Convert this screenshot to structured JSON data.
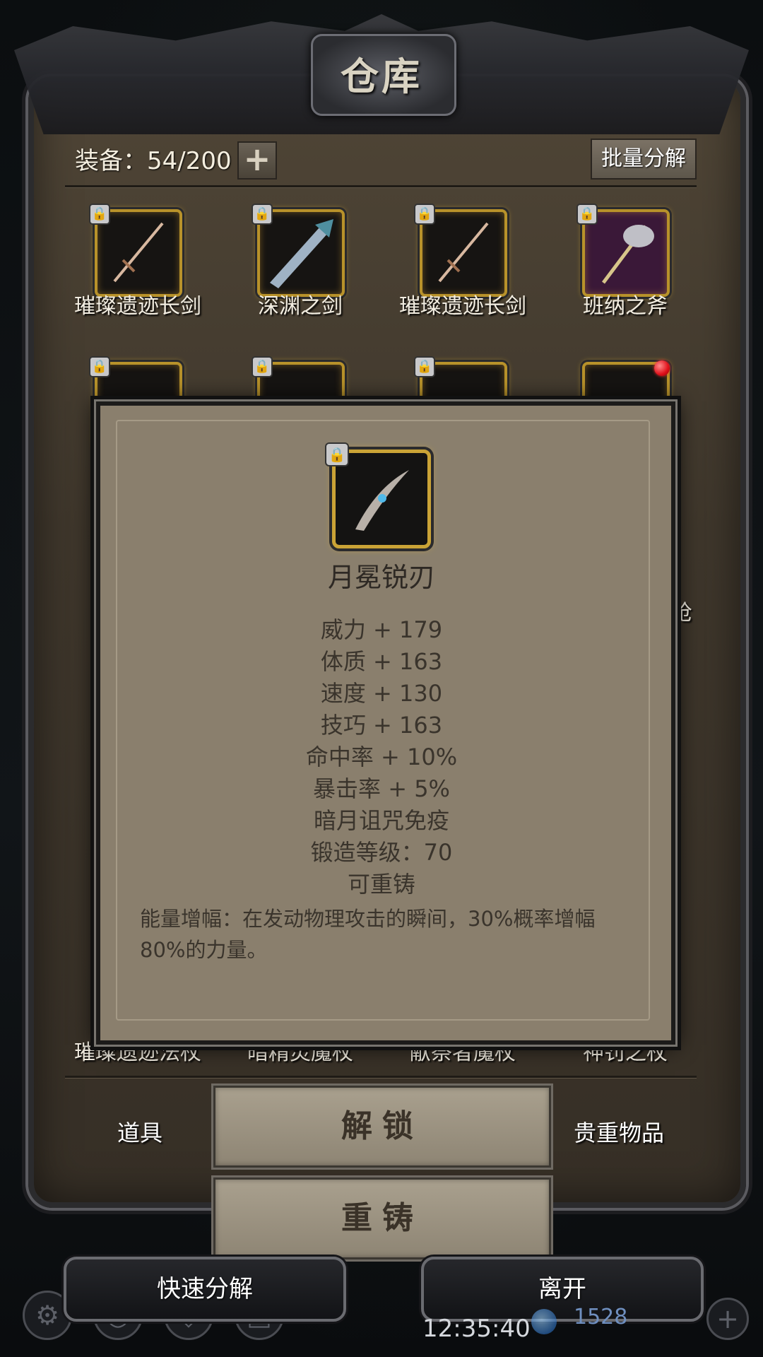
{
  "title": "仓库",
  "counter": "装备：54/200",
  "add_symbol": "+",
  "batch_button": "批量分解",
  "grid_row1": [
    {
      "label": "璀璨遗迹长剑",
      "icon": "longsword-icon"
    },
    {
      "label": "深渊之剑",
      "icon": "abyss-sword-icon"
    },
    {
      "label": "璀璨遗迹长剑",
      "icon": "longsword-icon"
    },
    {
      "label": "班纳之斧",
      "icon": "axe-icon"
    }
  ],
  "grid_row_last": [
    "璀璨遗迹法杖",
    "暗精灵魔杖",
    "献祭者魔杖",
    "神罚之杖"
  ],
  "peek_text": "枪",
  "tabs": {
    "left": "道具",
    "right": "贵重物品"
  },
  "actions": {
    "unlock": "解锁",
    "reforge": "重铸"
  },
  "footer": {
    "quick_decompose": "快速分解",
    "leave": "离开",
    "time": "12:35:40",
    "currency": "1528"
  },
  "detail": {
    "name": "月冕锐刃",
    "stats": [
      "威力 + 179",
      "体质 + 163",
      "速度 + 130",
      "技巧 + 163",
      "命中率 + 10%",
      "暴击率 + 5%",
      "暗月诅咒免疫",
      "锻造等级：70",
      "可重铸"
    ],
    "description": "能量增幅：在发动物理攻击的瞬间，30%概率增幅80%的力量。"
  },
  "colors": {
    "gold_frame": "#c9a032",
    "panel": "#4a4133",
    "popup": "#8a7f6d",
    "button": "#a9a08e"
  }
}
